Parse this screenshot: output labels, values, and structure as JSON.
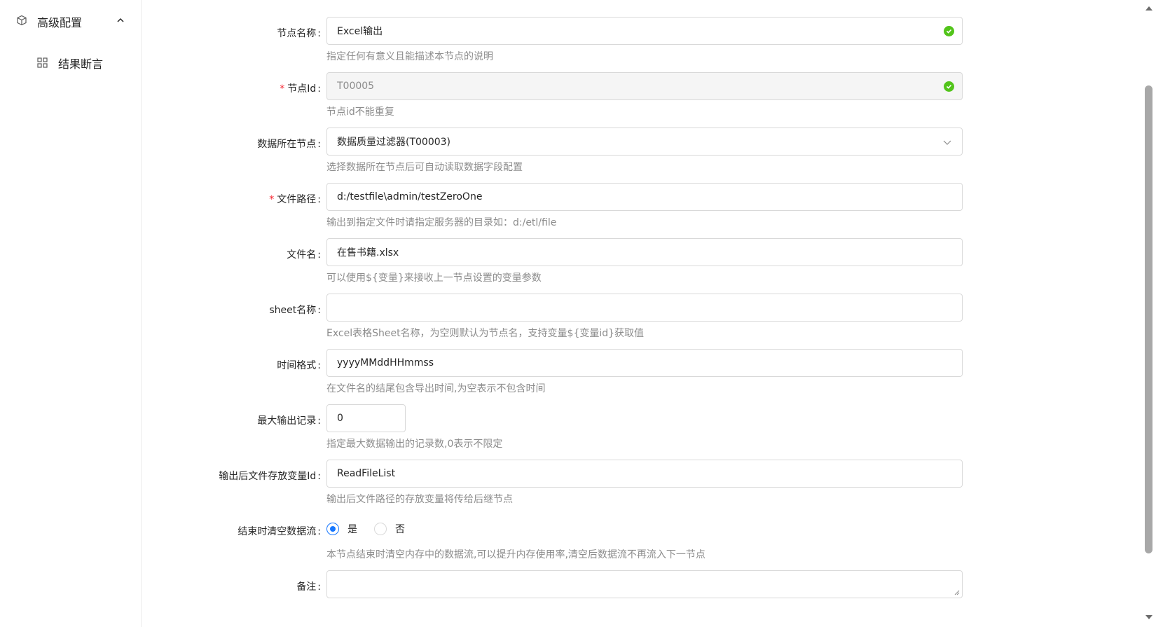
{
  "sidebar": {
    "group": {
      "label": "高级配置",
      "icon": "cube-icon",
      "expanded": true
    },
    "items": [
      {
        "label": "结果断言",
        "icon": "grid-icon"
      }
    ]
  },
  "form": {
    "fields": [
      {
        "key": "node_name",
        "label": "节点名称",
        "required": false,
        "value": "Excel输出",
        "placeholder": "",
        "help": "指定任何有意义且能描述本节点的说明",
        "valid": true,
        "disabled": false
      },
      {
        "key": "node_id",
        "label": "节点Id",
        "required": true,
        "value": "T00005",
        "placeholder": "",
        "help": "节点id不能重复",
        "valid": true,
        "disabled": true
      },
      {
        "key": "data_node",
        "label": "数据所在节点",
        "required": false,
        "value": "数据质量过滤器(T00003)",
        "help": "选择数据所在节点后可自动读取数据字段配置",
        "type": "select"
      },
      {
        "key": "file_path",
        "label": "文件路径",
        "required": true,
        "value": "d:/testfile\\admin/testZeroOne",
        "help": "输出到指定文件时请指定服务器的目录如：d:/etl/file"
      },
      {
        "key": "file_name",
        "label": "文件名",
        "required": false,
        "value": "在售书籍.xlsx",
        "help": "可以使用${变量}来接收上一节点设置的变量参数"
      },
      {
        "key": "sheet_name",
        "label": "sheet名称",
        "required": false,
        "value": "",
        "help": "Excel表格Sheet名称，为空则默认为节点名，支持变量${变量id}获取值"
      },
      {
        "key": "time_format",
        "label": "时间格式",
        "required": false,
        "value": "yyyyMMddHHmmss",
        "help": "在文件名的结尾包含导出时间,为空表示不包含时间"
      },
      {
        "key": "max_records",
        "label": "最大输出记录",
        "required": false,
        "value": "0",
        "help": "指定最大数据输出的记录数,0表示不限定",
        "type": "number"
      },
      {
        "key": "output_var",
        "label": "输出后文件存放变量Id",
        "required": false,
        "value": "ReadFileList",
        "help": "输出后文件路径的存放变量将传给后继节点"
      }
    ],
    "clear_stream": {
      "label": "结束时清空数据流",
      "options": [
        "是",
        "否"
      ],
      "selected": "是",
      "help": "本节点结束时清空内存中的数据流,可以提升内存使用率,清空后数据流不再流入下一节点"
    },
    "remark": {
      "label": "备注",
      "value": ""
    }
  },
  "colors": {
    "primary": "#1677ff",
    "success": "#52c41a",
    "required": "#f5222d",
    "help_text": "#8c8c8c",
    "border": "#d9d9d9"
  }
}
